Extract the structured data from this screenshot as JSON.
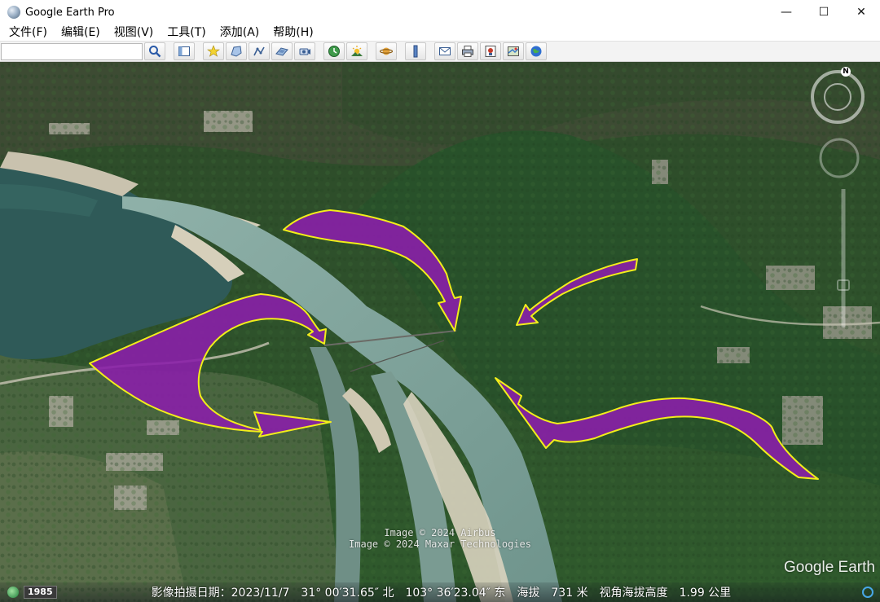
{
  "window": {
    "title": "Google Earth Pro",
    "controls": {
      "minimize": "—",
      "maximize": "☐",
      "close": "✕"
    }
  },
  "menu": [
    {
      "label": "文件(F)"
    },
    {
      "label": "编辑(E)"
    },
    {
      "label": "视图(V)"
    },
    {
      "label": "工具(T)"
    },
    {
      "label": "添加(A)"
    },
    {
      "label": "帮助(H)"
    }
  ],
  "toolbar": {
    "search_value": "",
    "buttons": [
      "search-icon",
      "sidebar-icon",
      "placemark-icon",
      "polygon-icon",
      "path-icon",
      "image-overlay-icon",
      "record-tour-icon",
      "historical-imagery-icon",
      "sunlight-icon",
      "planets-icon",
      "ruler-icon",
      "email-icon",
      "print-icon",
      "save-image-icon",
      "view-maps-icon",
      "earth-icon"
    ]
  },
  "viewer": {
    "copyright": [
      "Image © 2024 Airbus",
      "Image © 2024 Maxar Technologies"
    ],
    "logo": "Google Earth",
    "compass_label": "N"
  },
  "status": {
    "year": "1985",
    "date": "影像拍摄日期：2023/11/7",
    "lat": "31° 00′31.65″ 北",
    "lon": "103° 36′23.04″ 东",
    "elev_label": "海拔",
    "elev_value": "731 米",
    "eye_label": "视角海拔高度",
    "eye_value": "1.99 公里"
  },
  "colors": {
    "annotation_fill": "#8a1fa8",
    "annotation_stroke": "#f2ee1a",
    "river": "#7fa19a",
    "reservoir": "#2f5a58",
    "forest": "#2f5a2c"
  }
}
